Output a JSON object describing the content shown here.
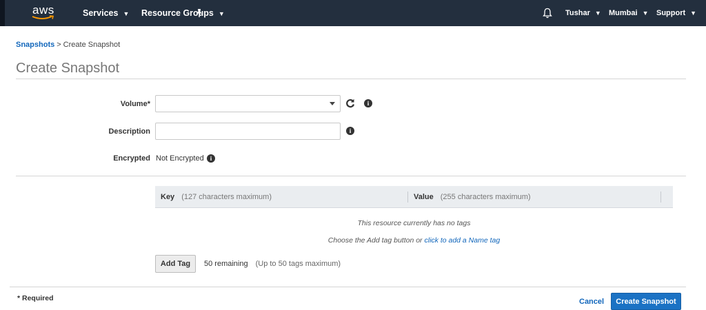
{
  "nav": {
    "logo_text": "aws",
    "services": "Services",
    "resource_groups": "Resource Groups",
    "user": "Tushar",
    "region": "Mumbai",
    "support": "Support"
  },
  "breadcrumb": {
    "parent": "Snapshots",
    "separator": ">",
    "current": "Create Snapshot"
  },
  "page_title": "Create Snapshot",
  "form": {
    "volume_label": "Volume*",
    "volume_value": "",
    "description_label": "Description",
    "description_value": "",
    "encrypted_label": "Encrypted",
    "encrypted_value": "Not Encrypted"
  },
  "tags": {
    "key_header": "Key",
    "key_hint": "(127 characters maximum)",
    "value_header": "Value",
    "value_hint": "(255 characters maximum)",
    "empty_message": "This resource currently has no tags",
    "add_hint_prefix": "Choose the Add tag button or",
    "add_hint_link": "click to add a Name tag",
    "add_button": "Add Tag",
    "remaining": "50 remaining",
    "max_hint": "(Up to 50 tags maximum)"
  },
  "footer": {
    "required": "* Required",
    "cancel": "Cancel",
    "create": "Create Snapshot"
  },
  "colors": {
    "nav_bg": "#232f3e",
    "link": "#1166bb",
    "primary": "#1b72c4",
    "aws_orange": "#ff9900"
  },
  "icons": [
    "aws-smile-icon",
    "chevron-down-icon",
    "pin-icon",
    "bell-icon",
    "refresh-icon",
    "info-icon"
  ]
}
